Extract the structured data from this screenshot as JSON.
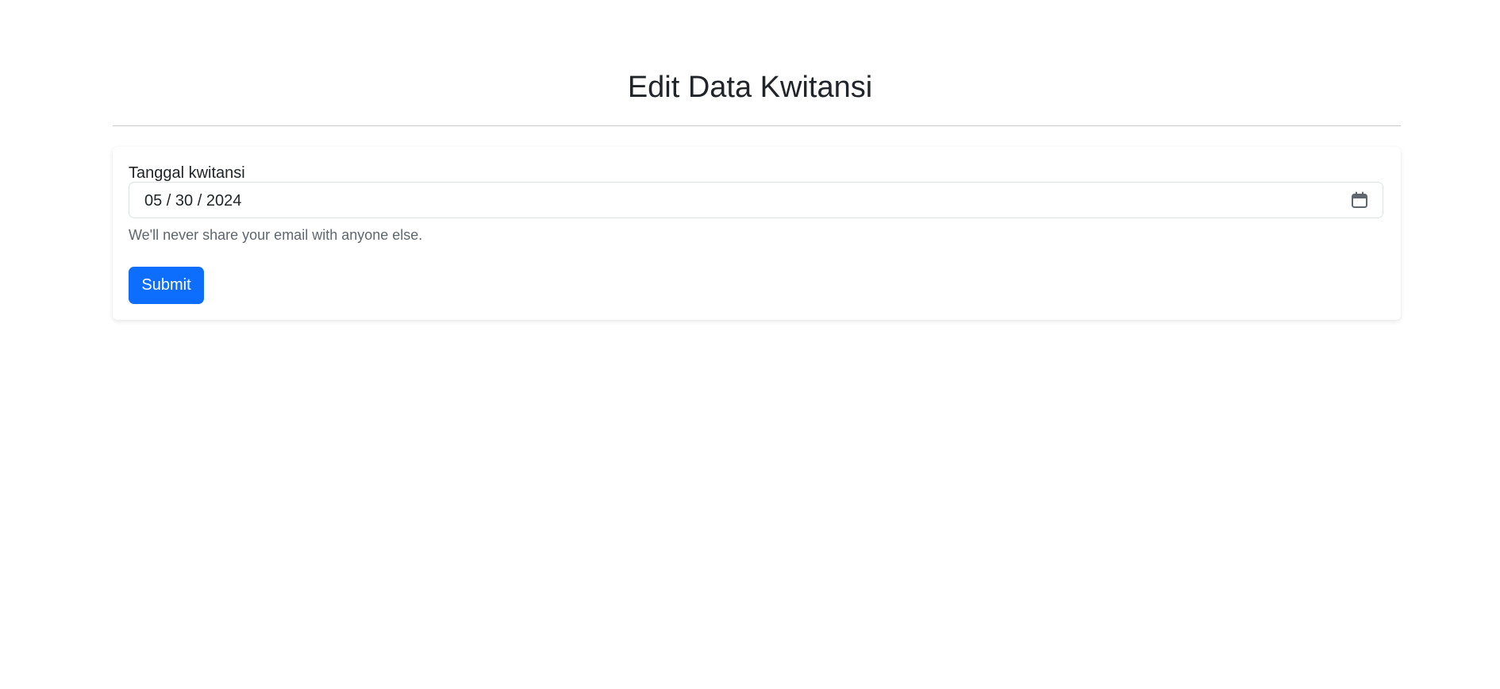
{
  "page": {
    "title": "Edit Data Kwitansi"
  },
  "form": {
    "date_label": "Tanggal kwitansi",
    "date_value": "05 / 30 / 2024",
    "help_text": "We'll never share your email with anyone else.",
    "submit_label": "Submit"
  },
  "icons": {
    "calendar": "calendar-icon"
  },
  "colors": {
    "primary": "#0d6efd",
    "text": "#212529",
    "muted": "#5f666d",
    "border": "#dee2e6"
  }
}
